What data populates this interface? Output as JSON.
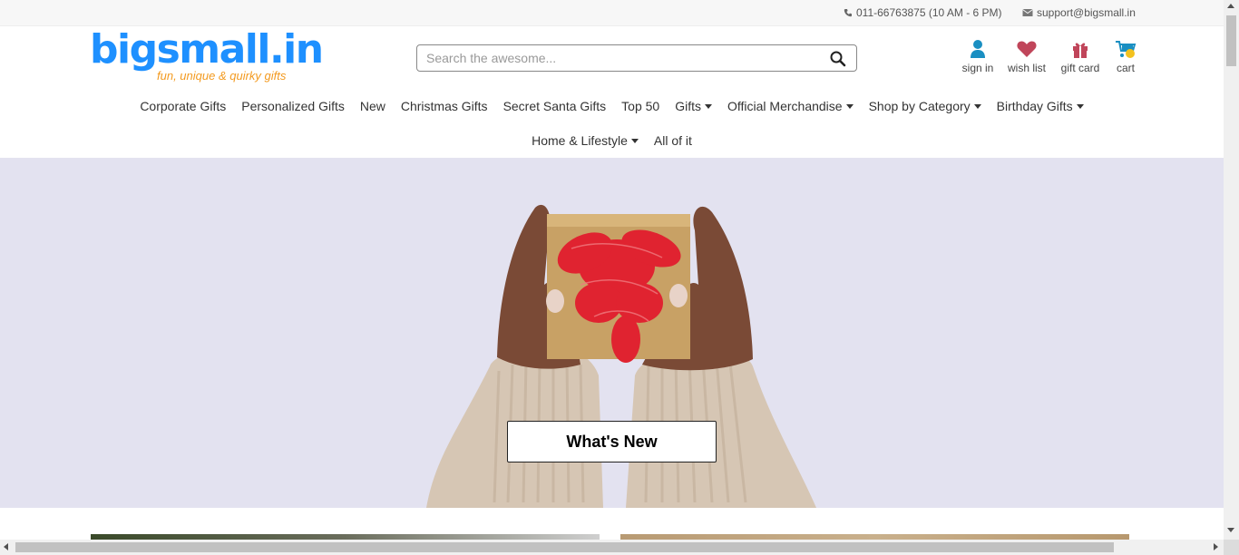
{
  "topbar": {
    "phone": "011-66763875 (10 AM - 6 PM)",
    "email": "support@bigsmall.in",
    "phone_icon": "phone-icon",
    "email_icon": "envelope-icon"
  },
  "logo": {
    "wordmark": "bigsmall.in",
    "tagline": "fun, unique & quirky gifts"
  },
  "search": {
    "placeholder": "Search the awesome...",
    "value": "",
    "icon": "search-icon"
  },
  "user_actions": [
    {
      "label": "sign in",
      "icon": "user-icon"
    },
    {
      "label": "wish list",
      "icon": "heart-icon"
    },
    {
      "label": "gift card",
      "icon": "gift-icon"
    },
    {
      "label": "cart",
      "icon": "cart-icon"
    }
  ],
  "nav": {
    "row1": [
      {
        "label": "Corporate Gifts"
      },
      {
        "label": "Personalized Gifts"
      },
      {
        "label": "New"
      },
      {
        "label": "Christmas Gifts"
      },
      {
        "label": "Secret Santa Gifts"
      },
      {
        "label": "Top 50"
      },
      {
        "label": "Gifts"
      },
      {
        "label": "Official Merchandise"
      },
      {
        "label": "Shop by Category"
      },
      {
        "label": "Birthday Gifts"
      }
    ],
    "row2": [
      {
        "label": "Home & Lifestyle"
      },
      {
        "label": "All of it"
      }
    ]
  },
  "hero": {
    "cta_label": "What's New"
  },
  "colors": {
    "brand_blue": "#1e90ff",
    "brand_orange": "#f39a1f",
    "icon_teal": "#1a8fc2",
    "icon_rose": "#c0455a",
    "hero_bg": "#e3e2f0"
  }
}
